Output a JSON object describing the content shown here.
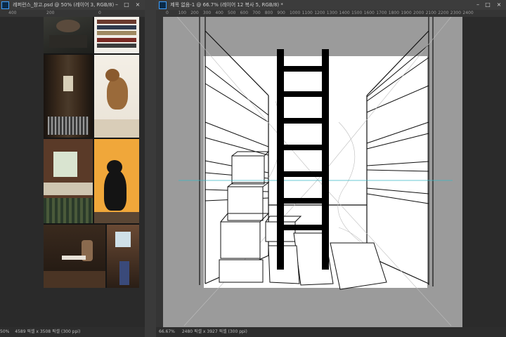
{
  "left_window": {
    "title": "레퍼런스_창고.psd @ 50% (레이어 3, RGB/8)",
    "ruler_ticks": [
      "400",
      "200",
      "0"
    ],
    "status_zoom": "50%",
    "status_info": "4589 픽셀 x 3508 픽셀 (300 ppi)"
  },
  "right_window": {
    "title": "제목 없음-1 @ 66.7% (레이어 12 복사 5, RGB/8) *",
    "ruler_ticks": [
      "0",
      "100",
      "200",
      "300",
      "400",
      "500",
      "600",
      "700",
      "800",
      "900",
      "1000",
      "1100",
      "1200",
      "1300",
      "1400",
      "1500",
      "1600",
      "1700",
      "1800",
      "1900",
      "2000",
      "2100",
      "2200",
      "2300",
      "2400"
    ],
    "status_zoom": "66.67%",
    "status_info": "2480 픽셀 x 3927 픽셀 (300 ppi)"
  },
  "colors": {
    "app_bg": "#2b2b2b",
    "pasteboard": "#9b9b9b",
    "guide": "#38b7c4",
    "ladder": "#000000"
  }
}
